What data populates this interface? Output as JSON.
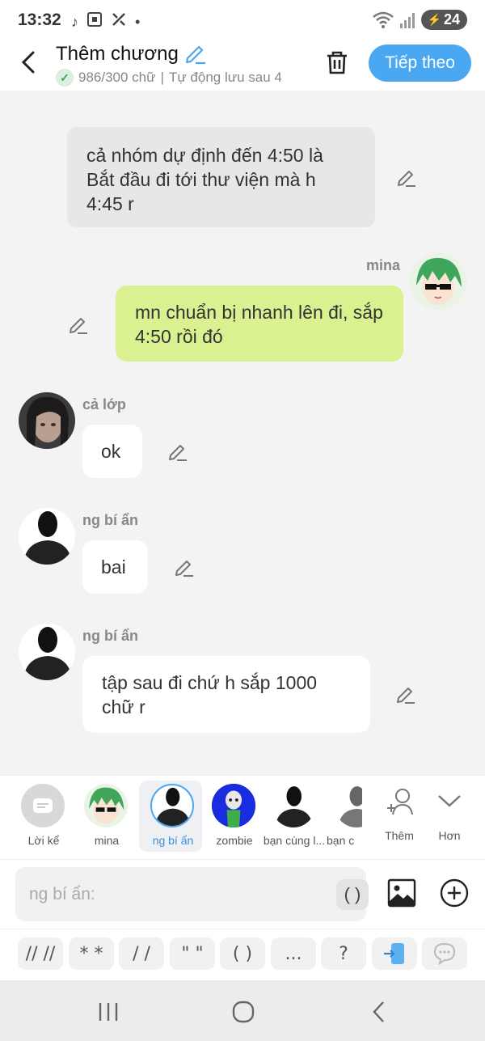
{
  "status_bar": {
    "time": "13:32",
    "left_icons": [
      "tiktok-icon",
      "screenshot-icon",
      "tools-icon",
      "dot-icon"
    ],
    "right_icons": [
      "wifi-icon",
      "signal-icon"
    ],
    "battery": "24"
  },
  "header": {
    "title": "Thêm chương",
    "word_count": "986/300 chữ",
    "separator": "|",
    "autosave": "Tự động lưu sau 4",
    "next_label": "Tiếp theo"
  },
  "messages": [
    {
      "type": "narration",
      "text": "cả nhóm dự định đến 4:50 là Bắt đầu đi tới thư viện mà h 4:45 r"
    },
    {
      "type": "mine",
      "speaker": "mina",
      "text": "mn chuẩn bị nhanh lên đi, sắp 4:50 rồi đó"
    },
    {
      "type": "other",
      "speaker": "cả lớp",
      "text": "ok"
    },
    {
      "type": "other",
      "speaker": "ng bí ẩn",
      "text": "bai"
    },
    {
      "type": "other",
      "speaker": "ng bí ẩn",
      "text": "tập sau đi chứ h sắp 1000 chữ r"
    }
  ],
  "characters": [
    {
      "label": "Lời kể",
      "icon": "narration-icon"
    },
    {
      "label": "mina",
      "icon": "anime-green-hair-avatar"
    },
    {
      "label": "ng bí ẩn",
      "icon": "silhouette-avatar",
      "selected": true
    },
    {
      "label": "zombie",
      "icon": "zombie-avatar"
    },
    {
      "label": "bạn cùng l...",
      "icon": "silhouette-avatar"
    },
    {
      "label": "bạn c",
      "icon": "silhouette-avatar"
    }
  ],
  "char_actions": {
    "add": "Thêm",
    "more": "Hơn"
  },
  "input": {
    "placeholder": "ng bí ẩn:",
    "paren": "( )"
  },
  "symbols": [
    "// //",
    "* *",
    "/ /",
    "\" \"",
    "( )",
    "...",
    "?"
  ],
  "colors": {
    "accent": "#4aa8f3",
    "mine_bubble": "#d9f191",
    "narration_bubble": "#e7e7e7"
  }
}
